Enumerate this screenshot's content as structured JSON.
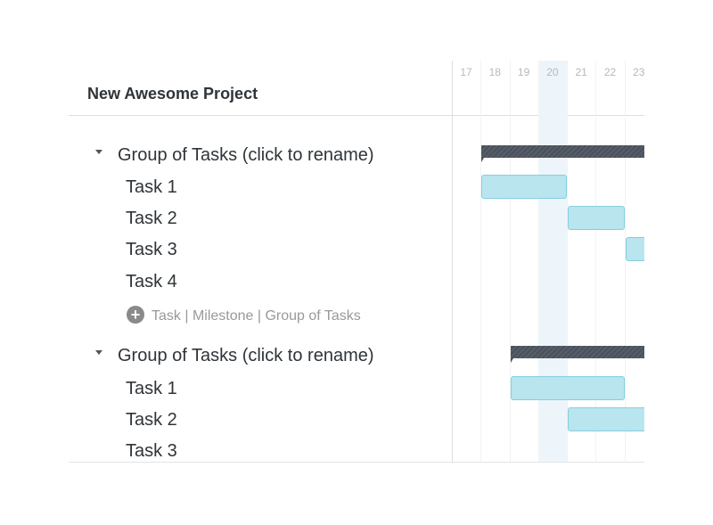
{
  "project": {
    "title": "New Awesome Project"
  },
  "timeline": {
    "days": [
      "17",
      "18",
      "19",
      "20",
      "21",
      "22",
      "23"
    ],
    "today": "20"
  },
  "groups": [
    {
      "label": "Group of Tasks (click to rename)",
      "bar": {
        "start": 18,
        "end": "beyond 23"
      },
      "tasks": [
        {
          "label": "Task 1",
          "start": 18,
          "end": 20
        },
        {
          "label": "Task 2",
          "start": 21,
          "end": 22
        },
        {
          "label": "Task 3",
          "start": 23,
          "end": "beyond 23"
        },
        {
          "label": "Task 4"
        }
      ]
    },
    {
      "label": "Group of Tasks (click to rename)",
      "bar": {
        "start": 19,
        "end": "beyond 23"
      },
      "tasks": [
        {
          "label": "Task 1",
          "start": 19,
          "end": 22
        },
        {
          "label": "Task 2",
          "start": 21,
          "end": "beyond 23"
        },
        {
          "label": "Task 3"
        }
      ]
    }
  ],
  "add_row": {
    "label": "Task | Milestone | Group of Tasks"
  },
  "colors": {
    "task_bar": "#b9e5ee",
    "group_bar": "#4f5661",
    "today": "#eef5fa"
  }
}
